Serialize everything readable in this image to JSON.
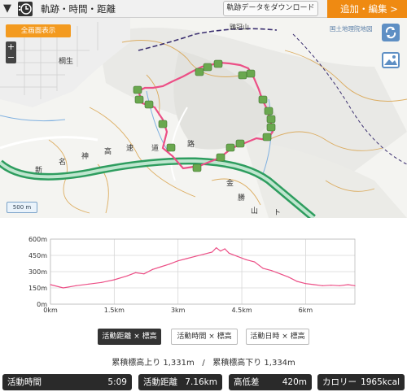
{
  "header": {
    "title": "軌跡・時間・距離",
    "download_label": "軌跡データをダウンロード",
    "add_edit_label": "追加・編集 >"
  },
  "map": {
    "fullscreen_label": "全画面表示",
    "zoom_in": "+",
    "zoom_out": "−",
    "attribution": "国土地理院地図",
    "scale_label": "500 m",
    "place_labels": {
      "kiryu": "桐生",
      "tsuganayama": "鶏冠山",
      "highway_chars": [
        "新",
        "名",
        "神",
        "高",
        "速",
        "道",
        "路"
      ],
      "road_chars": [
        "金",
        "勝",
        "山",
        "ト"
      ]
    },
    "track_color": "#ec4f86",
    "waypoint_color": "#6aa84f"
  },
  "chart_data": {
    "type": "line",
    "x": [
      0,
      0.3,
      0.6,
      0.9,
      1.2,
      1.5,
      1.8,
      2.0,
      2.2,
      2.4,
      2.6,
      2.8,
      3.0,
      3.2,
      3.4,
      3.6,
      3.8,
      3.9,
      4.0,
      4.1,
      4.2,
      4.4,
      4.6,
      4.8,
      5.0,
      5.2,
      5.4,
      5.6,
      5.8,
      6.0,
      6.2,
      6.4,
      6.6,
      6.8,
      7.0,
      7.16
    ],
    "y": [
      180,
      150,
      170,
      185,
      200,
      225,
      260,
      290,
      280,
      320,
      345,
      370,
      400,
      420,
      440,
      460,
      480,
      520,
      490,
      510,
      470,
      440,
      410,
      390,
      330,
      310,
      280,
      250,
      210,
      190,
      180,
      170,
      175,
      170,
      180,
      170
    ],
    "ylim": [
      0,
      600
    ],
    "xlim": [
      0,
      7.16
    ],
    "yticks": [
      "0m",
      "150m",
      "300m",
      "450m",
      "600m"
    ],
    "xticks": [
      "0km",
      "1.5km",
      "3km",
      "4.5km",
      "6km"
    ],
    "line_color": "#ec4f86"
  },
  "modes": [
    {
      "label": "活動距離 × 標高",
      "active": true
    },
    {
      "label": "活動時間 × 標高",
      "active": false
    },
    {
      "label": "活動日時 × 標高",
      "active": false
    }
  ],
  "elevation": {
    "up": "累積標高上り 1,331m",
    "sep": "/",
    "down": "累積標高下り 1,334m"
  },
  "stats": [
    {
      "label": "活動時間",
      "value": "5:09"
    },
    {
      "label": "活動距離",
      "value": "7.16km"
    },
    {
      "label": "高低差",
      "value": "420m"
    },
    {
      "label": "カロリー",
      "value": "1965kcal"
    }
  ]
}
